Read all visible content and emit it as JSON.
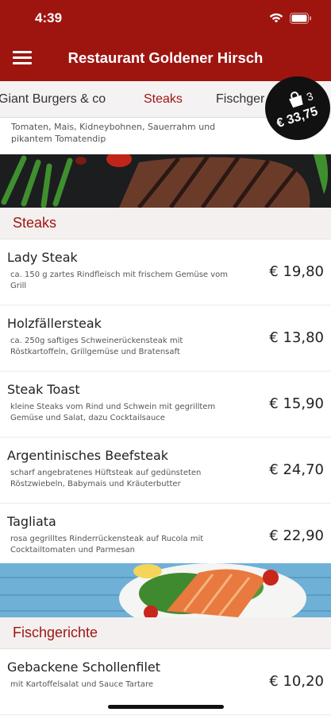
{
  "status": {
    "time": "4:39"
  },
  "header": {
    "title": "Restaurant Goldener Hirsch"
  },
  "tabs": [
    {
      "label": "Giant Burgers & co"
    },
    {
      "label": "Steaks"
    },
    {
      "label": "Fischger"
    }
  ],
  "cart": {
    "count": "3",
    "total": "€ 33,75"
  },
  "top_description": "Tomaten, Mais, Kidneybohnen, Sauerrahm und pikantem Tomatendip",
  "sections": [
    {
      "title": "Steaks",
      "items": [
        {
          "name": "Lady Steak",
          "description": "ca. 150 g zartes Rindfleisch mit frischem Gemüse vom Grill",
          "price": "€ 19,80"
        },
        {
          "name": "Holzfällersteak",
          "description": "ca. 250g saftiges Schweinerückensteak mit Röstkartoffeln, Grillgemüse und Bratensaft",
          "price": "€ 13,80"
        },
        {
          "name": "Steak Toast",
          "description": "kleine Steaks vom Rind und Schwein mit gegrilltem Gemüse und Salat, dazu Cocktailsauce",
          "price": "€ 15,90"
        },
        {
          "name": "Argentinisches Beefsteak",
          "description": "scharf angebratenes Hüftsteak auf gedünsteten Röstzwiebeln, Babymais und Kräuterbutter",
          "price": "€ 24,70"
        },
        {
          "name": "Tagliata",
          "description": "rosa gegrilltes Rinderrückensteak auf Rucola mit Cocktailtomaten und Parmesan",
          "price": "€ 22,90"
        }
      ]
    },
    {
      "title": "Fischgerichte",
      "items": [
        {
          "name": "Gebackene Schollenfilet",
          "description": "mit Kartoffelsalat und Sauce Tartare",
          "price": "€ 10,20"
        }
      ]
    }
  ],
  "icons": {
    "menu": "hamburger-menu-icon",
    "cart": "shopping-bag-icon",
    "wifi": "wifi-icon",
    "battery": "battery-icon"
  },
  "colors": {
    "brand": "#9e1510",
    "cart_bg": "#111111"
  }
}
